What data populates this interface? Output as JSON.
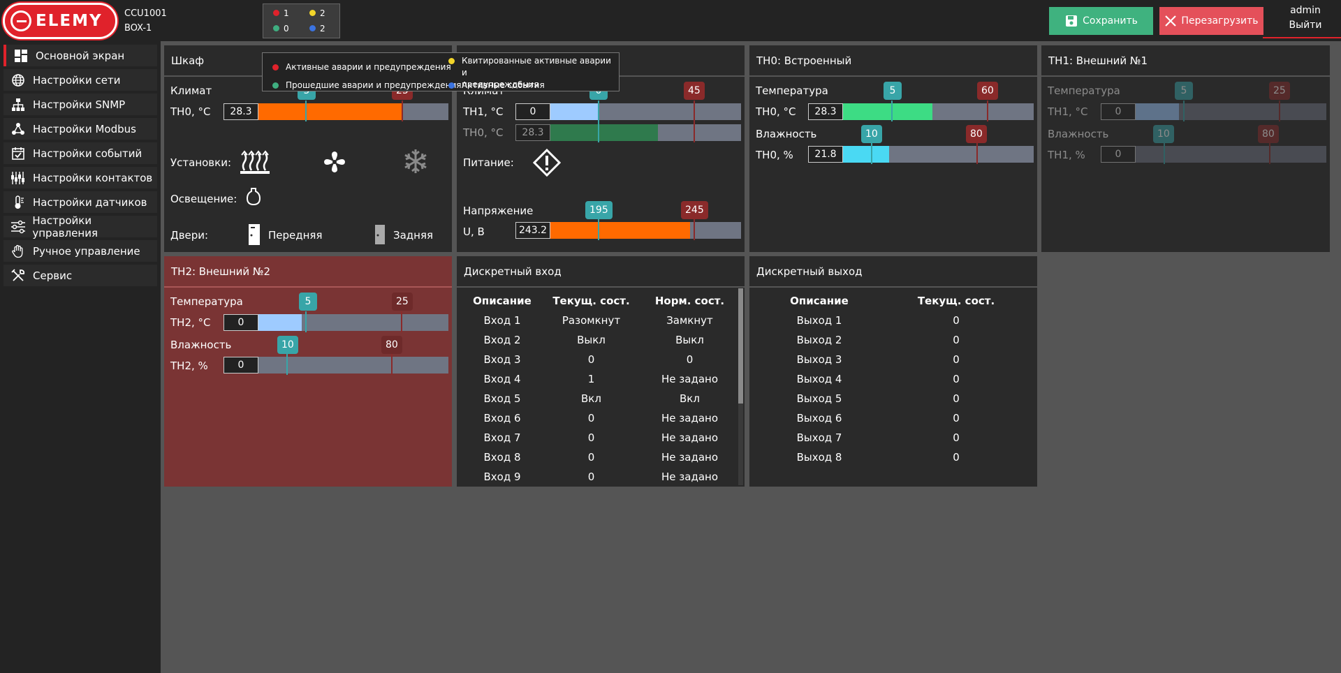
{
  "header": {
    "logo_text": "ELEMY",
    "device_model": "CCU1001",
    "device_name": "BOX-1",
    "counters": [
      {
        "color": "#e0222b",
        "value": "1"
      },
      {
        "color": "#f2d52a",
        "value": "2"
      },
      {
        "color": "#3fae80",
        "value": "0"
      },
      {
        "color": "#3b73e0",
        "value": "2"
      }
    ],
    "save_label": "Сохранить",
    "reboot_label": "Перезагрузить",
    "user": "admin",
    "logout": "Выйти"
  },
  "sidebar": {
    "items": [
      {
        "label": "Основной экран",
        "icon": "dashboard-icon"
      },
      {
        "label": "Настройки сети",
        "icon": "globe-icon"
      },
      {
        "label": "Настройки SNMP",
        "icon": "network-tree-icon"
      },
      {
        "label": "Настройки Modbus",
        "icon": "share-nodes-icon"
      },
      {
        "label": "Настройки событий",
        "icon": "calendar-check-icon"
      },
      {
        "label": "Настройки контактов",
        "icon": "contacts-icon"
      },
      {
        "label": "Настройки датчиков",
        "icon": "thermometer-icon"
      },
      {
        "label": "Настройки управления",
        "icon": "sliders-icon"
      },
      {
        "label": "Ручное управление",
        "icon": "hand-icon"
      },
      {
        "label": "Сервис",
        "icon": "tools-icon"
      }
    ]
  },
  "legend": {
    "active_alarms": "Активные аварии и предупреждения",
    "acked_alarms_1": "Квитированные активные аварии и",
    "acked_alarms_2": "предупреждения",
    "past_alarms": "Прошедшие аварии и предупреждения",
    "active_events": "Активные события"
  },
  "cabinet": {
    "title": "Шкаф",
    "climate": "Климат",
    "th_label": "TH0, °C",
    "th_value": "28.3",
    "lo": "5",
    "hi": "25",
    "fill_pct": 0.75,
    "installs": "Установки:",
    "lighting": "Освещение:",
    "doors": "Двери:",
    "door_front": "Передняя",
    "door_back": "Задняя"
  },
  "climate": {
    "climate": "Климат",
    "th1_label": "TH1, °C",
    "th1_value": "0",
    "th0_label": "TH0, °C",
    "th0_value": "28.3",
    "lo": "0",
    "hi": "45",
    "power": "Питание:",
    "voltage": "Напряжение",
    "u_label": "U, В",
    "u_value": "243.2",
    "u_lo": "195",
    "u_hi": "245"
  },
  "th0": {
    "title": "TH0: Встроенный",
    "temp": "Температура",
    "t_label": "TH0, °C",
    "t_value": "28.3",
    "t_lo": "5",
    "t_hi": "60",
    "hum": "Влажность",
    "h_label": "TH0, %",
    "h_value": "21.8",
    "h_lo": "10",
    "h_hi": "80"
  },
  "th1": {
    "title": "TH1: Внешний №1",
    "temp": "Температура",
    "t_label": "TH1, °C",
    "t_value": "0",
    "t_lo": "5",
    "t_hi": "25",
    "hum": "Влажность",
    "h_label": "TH1, %",
    "h_value": "0",
    "h_lo": "10",
    "h_hi": "80"
  },
  "th2": {
    "title": "TH2: Внешний №2",
    "temp": "Температура",
    "t_label": "TH2, °C",
    "t_value": "0",
    "t_lo": "5",
    "t_hi": "25",
    "hum": "Влажность",
    "h_label": "TH2, %",
    "h_value": "0",
    "h_lo": "10",
    "h_hi": "80"
  },
  "dinputs": {
    "title": "Дискретный вход",
    "columns": [
      "Описание",
      "Текущ. сост.",
      "Норм. сост."
    ],
    "rows": [
      [
        "Вход 1",
        "Разомкнут",
        "Замкнут"
      ],
      [
        "Вход 2",
        "Выкл",
        "Выкл"
      ],
      [
        "Вход 3",
        "0",
        "0"
      ],
      [
        "Вход 4",
        "1",
        "Не задано"
      ],
      [
        "Вход 5",
        "Вкл",
        "Вкл"
      ],
      [
        "Вход 6",
        "0",
        "Не задано"
      ],
      [
        "Вход 7",
        "0",
        "Не задано"
      ],
      [
        "Вход 8",
        "0",
        "Не задано"
      ],
      [
        "Вход 9",
        "0",
        "Не задано"
      ]
    ]
  },
  "doutputs": {
    "title": "Дискретный выход",
    "columns": [
      "Описание",
      "Текущ. сост."
    ],
    "rows": [
      [
        "Выход 1",
        "0"
      ],
      [
        "Выход 2",
        "0"
      ],
      [
        "Выход 3",
        "0"
      ],
      [
        "Выход 4",
        "0"
      ],
      [
        "Выход 5",
        "0"
      ],
      [
        "Выход 6",
        "0"
      ],
      [
        "Выход 7",
        "0"
      ],
      [
        "Выход 8",
        "0"
      ]
    ]
  },
  "colors": {
    "accent_red": "#e0222b",
    "save_green": "#3fb27f",
    "reboot_red": "#e4505a",
    "orange_fill": "#ff6a00",
    "blue_fill": "#9ecbff",
    "green_fill": "#3ddc84",
    "cyan_fill": "#4ad9f3",
    "alarm_panel": "#7a3434"
  }
}
